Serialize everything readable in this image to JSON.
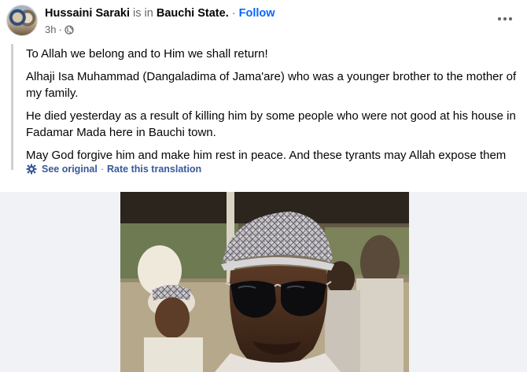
{
  "post": {
    "author": "Hussaini Saraki",
    "is_in": "is in",
    "location": "Bauchi State.",
    "separator": "·",
    "follow": "Follow",
    "time": "3h",
    "time_separator": "·",
    "privacy_icon": "globe-icon",
    "more_icon": "more-horizontal-icon"
  },
  "translation": {
    "paragraphs": [
      "To Allah we belong and to Him we shall return!",
      "Alhaji Isa Muhammad (Dangaladima of Jama'are) who was a younger brother to the mother of my family.",
      "He died yesterday as a result of killing him by some people who were not good at his house in Fadamar Mada here in Bauchi town.",
      "May God forgive him and make him rest in peace. And these tyrants may Allah expose them"
    ],
    "settings_icon": "gear-icon",
    "see_original": "See original",
    "separator": "·",
    "rate": "Rate this translation"
  },
  "colors": {
    "link_blue": "#0866ff",
    "secondary_text": "#65676b",
    "translation_link": "#385898"
  }
}
